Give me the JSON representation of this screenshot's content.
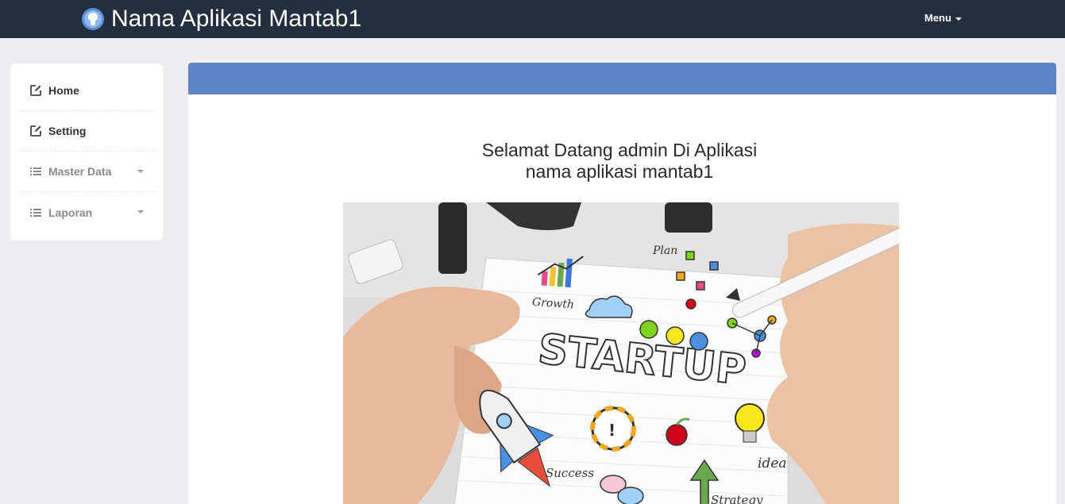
{
  "app": {
    "title": "Nama Aplikasi Mantab1"
  },
  "navbar": {
    "menu_label": "Menu"
  },
  "sidebar": {
    "items": [
      {
        "label": "Home",
        "icon": "edit-icon",
        "dropdown": false
      },
      {
        "label": "Setting",
        "icon": "edit-icon",
        "dropdown": false
      },
      {
        "label": "Master Data",
        "icon": "list-icon",
        "dropdown": true
      },
      {
        "label": "Laporan",
        "icon": "list-icon",
        "dropdown": true
      }
    ]
  },
  "main": {
    "welcome_line1": "Selamat Datang admin Di Aplikasi",
    "welcome_line2": "nama aplikasi mantab1",
    "illustration": {
      "word": "STARTUP",
      "labels": [
        "Plan",
        "Growth",
        "Success",
        "idea",
        "Strategy"
      ]
    }
  },
  "colors": {
    "navbar": "#232e3e",
    "panel_heading": "#5b85c8",
    "background": "#eeedf1"
  }
}
